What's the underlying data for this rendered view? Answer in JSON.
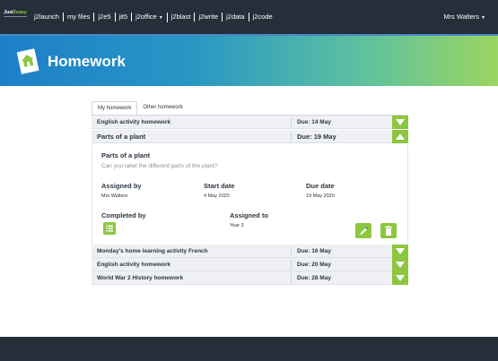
{
  "topbar": {
    "logo": {
      "part1": "Just",
      "part2": "2easy"
    },
    "menu": [
      {
        "label": "j2launch",
        "caret": false
      },
      {
        "label": "my files",
        "caret": false
      },
      {
        "label": "j2e5",
        "caret": false
      },
      {
        "label": "jit5",
        "caret": false
      },
      {
        "label": "j2office",
        "caret": true
      },
      {
        "label": "j2blast",
        "caret": false
      },
      {
        "label": "j2write",
        "caret": false
      },
      {
        "label": "j2data",
        "caret": false
      },
      {
        "label": "j2code",
        "caret": false
      }
    ],
    "user": "Mrs Walters",
    "caret_glyph": "▼"
  },
  "banner": {
    "title": "Homework",
    "icon": "homework-house-icon"
  },
  "tabs": [
    "My homework",
    "Other homework"
  ],
  "rows": [
    {
      "name": "English activity homework",
      "due": "Due: 14 May",
      "open": false
    },
    {
      "name": "Parts of a plant",
      "due": "Due: 19 May",
      "open": true
    },
    {
      "name": "Monday's home learning activity French",
      "due": "Due: 16 May",
      "open": false
    },
    {
      "name": "English activity homework",
      "due": "Due: 20 May",
      "open": false
    },
    {
      "name": "World War 2 History homework",
      "due": "Due: 28 May",
      "open": false
    }
  ],
  "detail": {
    "title": "Parts of a plant",
    "description": "Can you label the different parts of the plant?",
    "assigned_by_label": "Assigned by",
    "assigned_by": "Mrs Walters",
    "start_date_label": "Start date",
    "start_date": "4 May 2020",
    "due_date_label": "Due date",
    "due_date": "19 May 2020",
    "completed_by_label": "Completed by",
    "assigned_to_label": "Assigned to",
    "assigned_to": "Year 3"
  },
  "colors": {
    "topbar": "#252f3a",
    "accent_green": "#8dc63f",
    "banner_start": "#1e7fc7",
    "banner_end": "#9bd561"
  }
}
